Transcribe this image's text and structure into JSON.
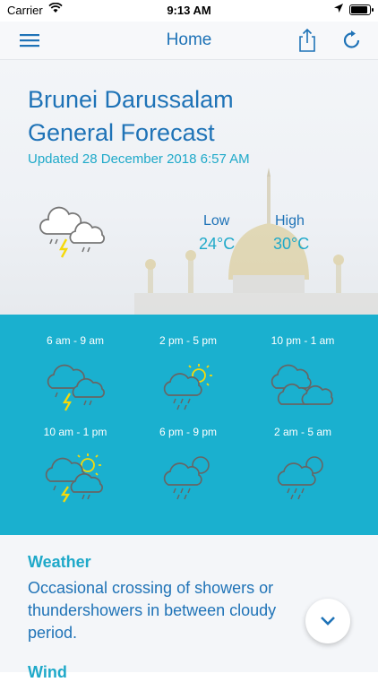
{
  "status_bar": {
    "carrier": "Carrier",
    "time": "9:13 AM"
  },
  "nav": {
    "title": "Home"
  },
  "forecast": {
    "title_line1": "Brunei Darussalam",
    "title_line2": "General Forecast",
    "updated": "Updated 28 December 2018 6:57 AM",
    "low_label": "Low",
    "low_value": "24°C",
    "high_label": "High",
    "high_value": "30°C"
  },
  "periods": [
    {
      "label": "6 am - 9 am",
      "icon": "thunderstorm-cloud-icon"
    },
    {
      "label": "2 pm - 5 pm",
      "icon": "sun-rain-cloud-icon"
    },
    {
      "label": "10 pm - 1 am",
      "icon": "cloudy-icon"
    },
    {
      "label": "10 am - 1 pm",
      "icon": "sun-thunderstorm-icon"
    },
    {
      "label": "6 pm - 9 pm",
      "icon": "moon-rain-cloud-icon"
    },
    {
      "label": "2 am - 5 am",
      "icon": "moon-rain-cloud-icon"
    }
  ],
  "details": {
    "weather_heading": "Weather",
    "weather_text": "Occasional crossing of showers or thundershowers in between cloudy period.",
    "wind_heading": "Wind"
  },
  "colors": {
    "brand": "#1f73b7",
    "accent": "#1fa9c9",
    "band": "#1ab0cf",
    "sun": "#f5d90a"
  }
}
